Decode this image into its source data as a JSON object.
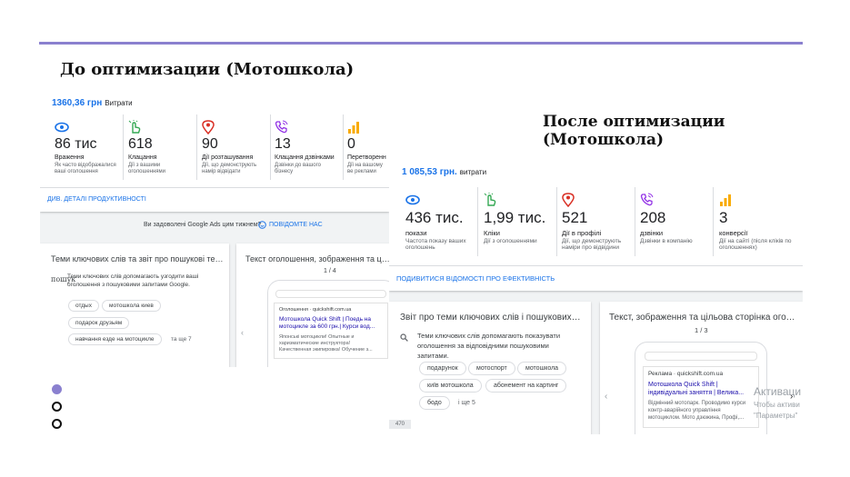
{
  "slide": {
    "before_title": "До оптимизации (Мотошкола)",
    "after_title": "После оптимизации (Мотошкола)"
  },
  "before": {
    "cost_amount": "1360,36 грн",
    "cost_label": "Витрати",
    "metrics": [
      {
        "icon": "eye-icon",
        "value": "86 тис",
        "name": "Враження",
        "sub": "Як часто відображалися ваші оголошення"
      },
      {
        "icon": "click-hand-icon",
        "value": "618",
        "name": "Клацання",
        "sub": "Дії з вашими оголошеннями"
      },
      {
        "icon": "location-pin-icon",
        "value": "90",
        "name": "Дії розташування",
        "sub": "Дії, що демонструють намір відвідати"
      },
      {
        "icon": "phone-call-icon",
        "value": "13",
        "name": "Клацання дзвінками",
        "sub": "Дзвінки до вашого бізнесу"
      },
      {
        "icon": "bar-chart-icon",
        "value": "0",
        "name": "Перетворенн",
        "sub": "Дії на вашому ве реклами"
      }
    ],
    "details_link": "ДИВ. ДЕТАЛІ ПРОДУКТИВНОСТІ",
    "feedback_question": "Ви задоволені Google Ads цим тижнем?",
    "feedback_link": "ПОВІДОМТЕ НАС",
    "keywords_card": {
      "title": "Теми ключових слів та звіт про пошукові тер...",
      "search_label": "пошук",
      "description": "Теми ключових слів допомагають узгодити ваші оголошення з пошуковими запитами Google.",
      "chips": [
        "отдых",
        "мотошкола киев",
        "подарок друзьям",
        "навчання езде на мотоцикле"
      ],
      "more": "та ще 7"
    },
    "ad_card": {
      "title": "Текст оголошення, зображення та цільо",
      "pager": "1 / 4",
      "ad_label": "Оголошення · quickshift.com.ua",
      "ad_title": "Мотошкола Quick Shift | Поедь на мотоцикле за 600 грн.| Курси вод...",
      "ad_body": "Японські мотоцикли! Опытные и харизматические инструктора! Качественная экипировка! Обучение з..."
    }
  },
  "after": {
    "cost_amount": "1 085,53 грн.",
    "cost_label": "витрати",
    "metrics": [
      {
        "icon": "eye-icon",
        "value": "436 тис.",
        "name": "покази",
        "sub": "Частота показу ваших оголошень"
      },
      {
        "icon": "click-hand-icon",
        "value": "1,99 тис.",
        "name": "Кліки",
        "sub": "Дії з оголошеннями"
      },
      {
        "icon": "location-pin-icon",
        "value": "521",
        "name": "Дії в профілі",
        "sub": "Дії, що демонструють наміри про відвідини"
      },
      {
        "icon": "phone-call-icon",
        "value": "208",
        "name": "дзвінки",
        "sub": "Дзвінки в компанію"
      },
      {
        "icon": "bar-chart-icon",
        "value": "3",
        "name": "конверсії",
        "sub": "Дії на сайті (після кліків по оголошеннях)"
      }
    ],
    "details_link": "ПОДИВИТИСЯ ВІДОМОСТІ ПРО ЕФЕКТИВНІСТЬ",
    "keywords_card": {
      "title": "Звіт про теми ключових слів і пошукових запи...",
      "description": "Теми ключових слів допомагають показувати оголошення за відповідними пошуковими запитами.",
      "chips": [
        "подарунок",
        "мотоспорт",
        "мотошкола",
        "київ мотошкола",
        "абонемент на картинг",
        "бодо"
      ],
      "more": "і ще 5",
      "footer_badge": "470"
    },
    "ad_card": {
      "title": "Текст, зображення та цільова сторінка оголошен...",
      "pager": "1 / 3",
      "ad_label": "Реклама · quickshift.com.ua",
      "ad_title": "Мотошкола Quick Shift | індивідуальні заняття | Велика...",
      "ad_body": "Відмінний мотопарк. Проводимо курси контр-аварійного управління мотоциклом. Мото дзюжина, Профі,..."
    },
    "watermark_title": "Активаци",
    "watermark_line1": "Чтобы активи",
    "watermark_line2": "\"Параметры\""
  },
  "colors": {
    "accent": "#8a80cf",
    "link": "#1a73e8",
    "eye": "#1a73e8",
    "click": "#34a853",
    "pin": "#d93025",
    "phone": "#9334e6",
    "chart": "#f9ab00"
  }
}
